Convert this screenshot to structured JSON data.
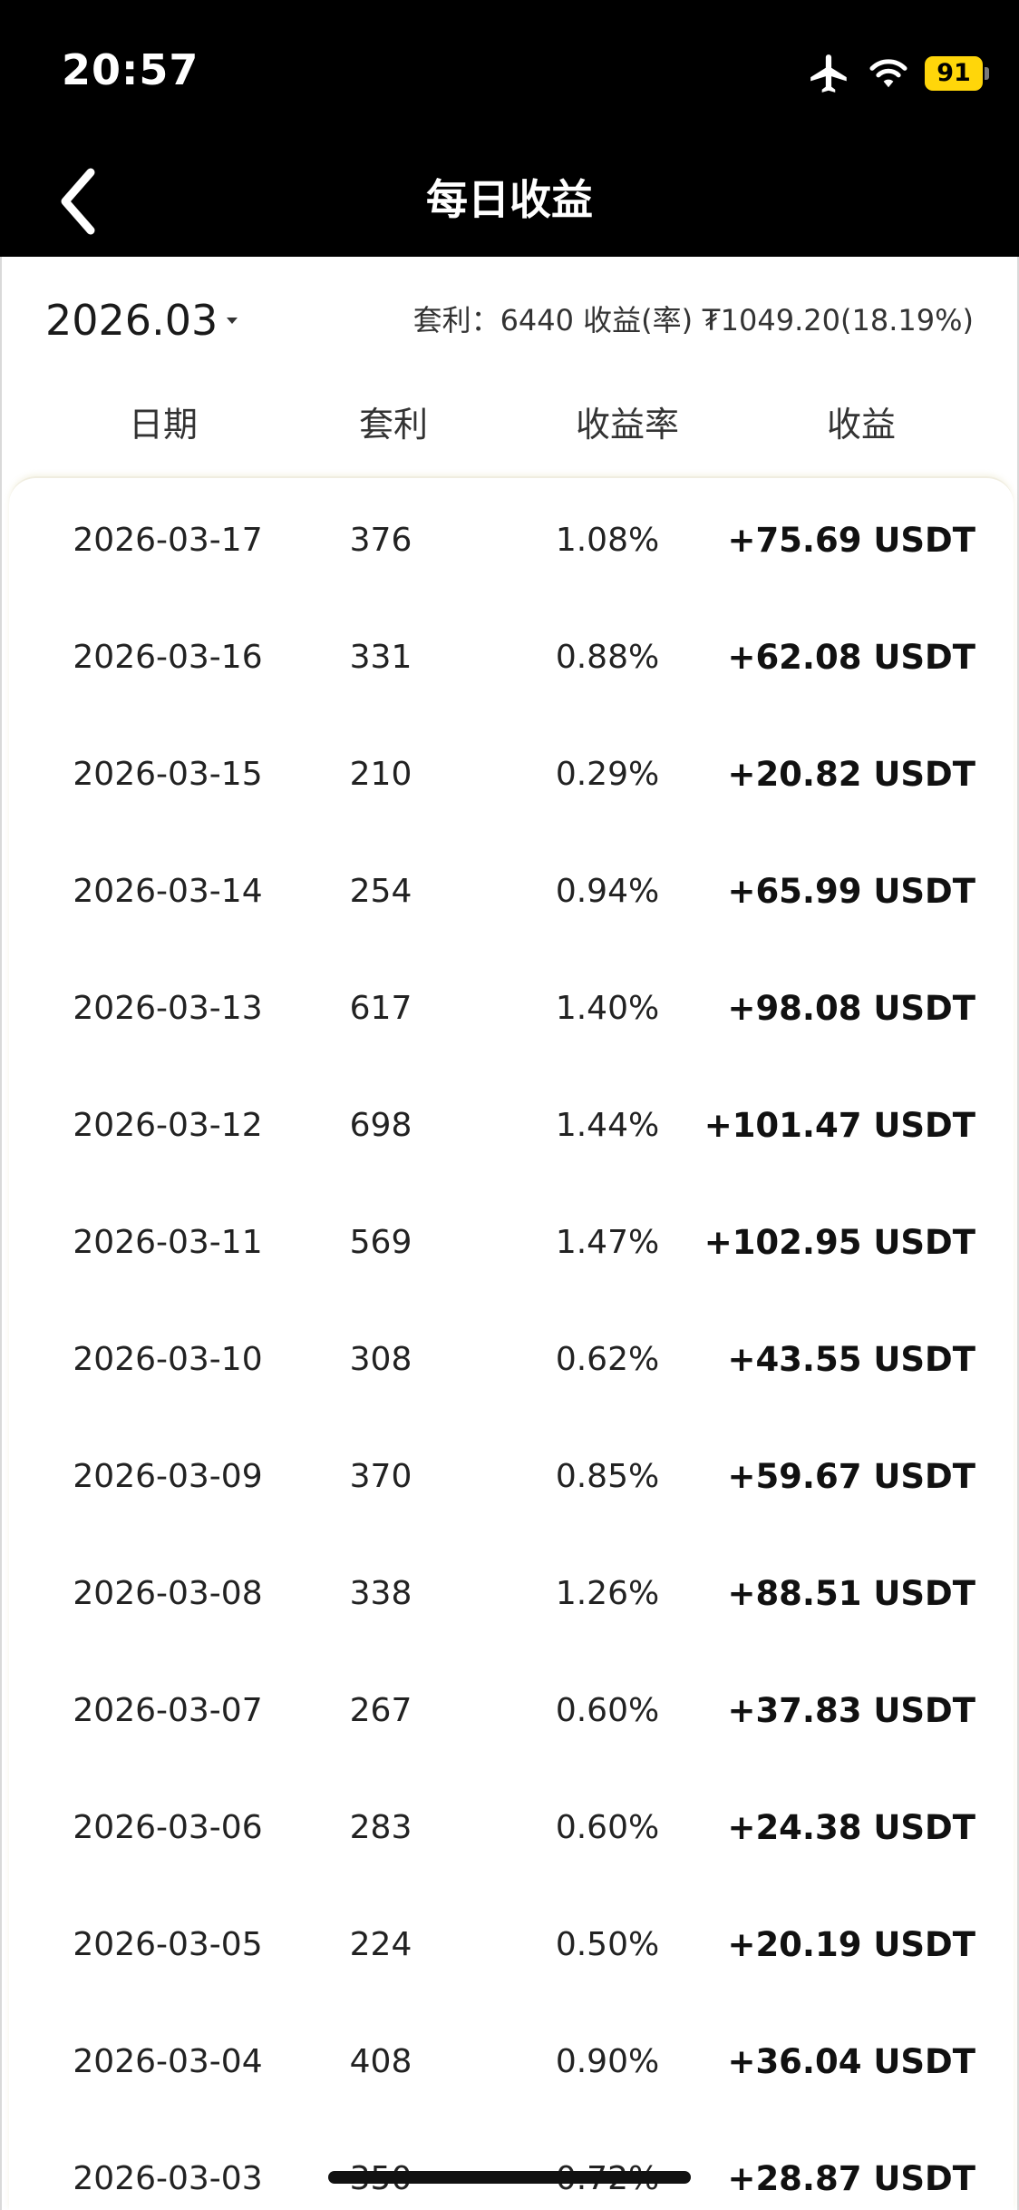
{
  "status_bar": {
    "time": "20:57",
    "battery": "91",
    "icons": [
      "airplane-icon",
      "wifi-icon",
      "battery-icon"
    ],
    "battery_color": "#ffd60a"
  },
  "nav": {
    "title": "每日收益",
    "back_icon": "chevron-left-icon"
  },
  "summary": {
    "month": "2026.03",
    "text": "套利：6440  收益(率) ₮1049.20(18.19%)"
  },
  "table": {
    "headers": [
      "日期",
      "套利",
      "收益率",
      "收益"
    ],
    "rows": [
      {
        "date": "2026-03-17",
        "count": "376",
        "rate": "1.08%",
        "profit": "+75.69 USDT"
      },
      {
        "date": "2026-03-16",
        "count": "331",
        "rate": "0.88%",
        "profit": "+62.08 USDT"
      },
      {
        "date": "2026-03-15",
        "count": "210",
        "rate": "0.29%",
        "profit": "+20.82 USDT"
      },
      {
        "date": "2026-03-14",
        "count": "254",
        "rate": "0.94%",
        "profit": "+65.99 USDT"
      },
      {
        "date": "2026-03-13",
        "count": "617",
        "rate": "1.40%",
        "profit": "+98.08 USDT"
      },
      {
        "date": "2026-03-12",
        "count": "698",
        "rate": "1.44%",
        "profit": "+101.47 USDT"
      },
      {
        "date": "2026-03-11",
        "count": "569",
        "rate": "1.47%",
        "profit": "+102.95 USDT"
      },
      {
        "date": "2026-03-10",
        "count": "308",
        "rate": "0.62%",
        "profit": "+43.55 USDT"
      },
      {
        "date": "2026-03-09",
        "count": "370",
        "rate": "0.85%",
        "profit": "+59.67 USDT"
      },
      {
        "date": "2026-03-08",
        "count": "338",
        "rate": "1.26%",
        "profit": "+88.51 USDT"
      },
      {
        "date": "2026-03-07",
        "count": "267",
        "rate": "0.60%",
        "profit": "+37.83 USDT"
      },
      {
        "date": "2026-03-06",
        "count": "283",
        "rate": "0.60%",
        "profit": "+24.38 USDT"
      },
      {
        "date": "2026-03-05",
        "count": "224",
        "rate": "0.50%",
        "profit": "+20.19 USDT"
      },
      {
        "date": "2026-03-04",
        "count": "408",
        "rate": "0.90%",
        "profit": "+36.04 USDT"
      },
      {
        "date": "2026-03-03",
        "count": "350",
        "rate": "0.72%",
        "profit": "+28.87 USDT"
      }
    ]
  }
}
